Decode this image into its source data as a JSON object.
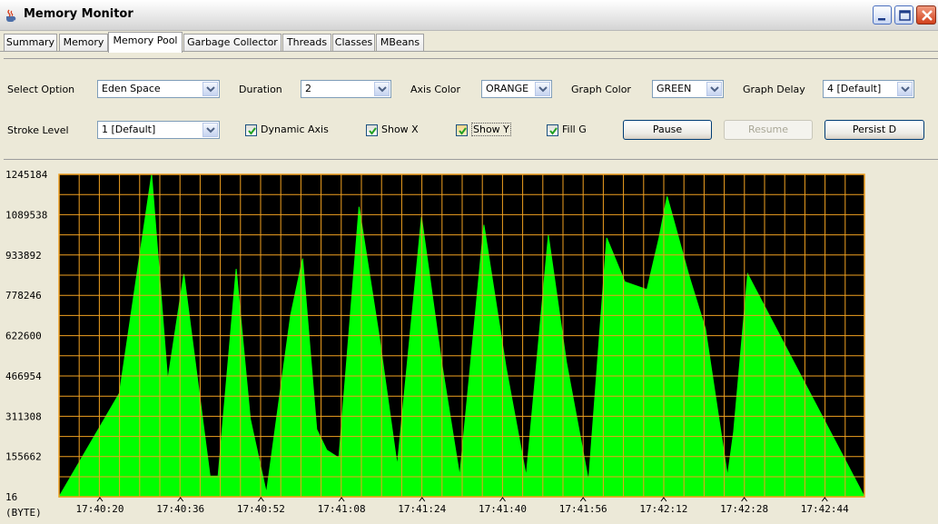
{
  "window": {
    "title": "Memory Monitor"
  },
  "tabs": [
    {
      "label": "Summary",
      "active": false
    },
    {
      "label": "Memory",
      "active": false
    },
    {
      "label": "Memory Pool",
      "active": true
    },
    {
      "label": "Garbage Collector",
      "active": false
    },
    {
      "label": "Threads",
      "active": false
    },
    {
      "label": "Classes",
      "active": false
    },
    {
      "label": "MBeans",
      "active": false
    }
  ],
  "controls": {
    "select_option": {
      "label": "Select Option",
      "value": "Eden Space"
    },
    "duration": {
      "label": "Duration",
      "value": "2"
    },
    "axis_color": {
      "label": "Axis Color",
      "value": "ORANGE"
    },
    "graph_color": {
      "label": "Graph Color",
      "value": "GREEN"
    },
    "graph_delay": {
      "label": "Graph Delay",
      "value": "4 [Default]"
    },
    "stroke_level": {
      "label": "Stroke Level",
      "value": "1 [Default]"
    },
    "dynamic_axis": {
      "label": "Dynamic Axis",
      "checked": true
    },
    "show_x": {
      "label": "Show X",
      "checked": true
    },
    "show_y": {
      "label": "Show Y",
      "checked": true
    },
    "fill_g": {
      "label": "Fill G",
      "checked": true
    },
    "pause_label": "Pause",
    "resume_label": "Resume",
    "persist_label": "Persist D"
  },
  "colors": {
    "axis": "#f0a020",
    "graph": "#00ff00",
    "plot_bg": "#000000"
  },
  "chart_data": {
    "type": "area",
    "ylabel": "(BYTE)",
    "yticks": [
      "1245184",
      "1089538",
      "933892",
      "778246",
      "622600",
      "466954",
      "311308",
      "155662",
      "16"
    ],
    "xticks": [
      "17:40:20",
      "17:40:36",
      "17:40:52",
      "17:41:08",
      "17:41:24",
      "17:41:40",
      "17:41:56",
      "17:42:12",
      "17:42:28",
      "17:42:44"
    ],
    "ylim": [
      16,
      1245184
    ],
    "grid": true,
    "series": [
      {
        "x": [
          15.0,
          23.0,
          27.0,
          31.0,
          37.5,
          39.5,
          44.0,
          47.5,
          51.5,
          57.5,
          60.5,
          64.0,
          66.5,
          69.5,
          74.5,
          79.5,
          84.0,
          90.0,
          95.0,
          99.5,
          105.5,
          111.0,
          116.0,
          121.5,
          126.0,
          131.5,
          136.0,
          140.5,
          146.0,
          149.0,
          151.0,
          156.5,
          160.5,
          166.0,
          167.5,
          171.0
        ],
        "y": [
          400000,
          1245184,
          450000,
          860000,
          80000,
          80000,
          880000,
          300000,
          15000,
          700000,
          920000,
          260000,
          180000,
          150000,
          1120000,
          620000,
          120000,
          1080000,
          520000,
          80000,
          1050000,
          500000,
          80000,
          1010000,
          520000,
          60000,
          1000000,
          830000,
          800000,
          1000000,
          1160000,
          850000,
          650000,
          80000,
          250000,
          860000
        ]
      }
    ]
  }
}
